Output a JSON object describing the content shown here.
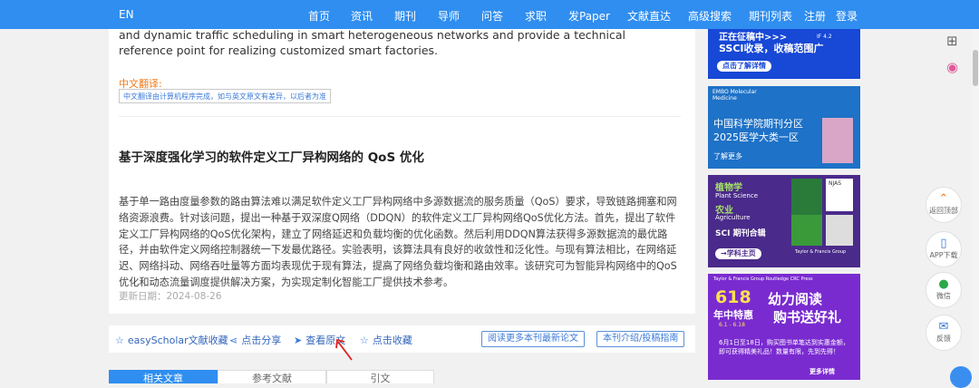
{
  "nav": {
    "lang": "EN",
    "items": [
      "首页",
      "资讯",
      "期刊",
      "导师",
      "问答",
      "求职",
      "发Paper",
      "文献直达",
      "高级搜索",
      "期刊列表",
      "注册",
      "登录"
    ]
  },
  "article": {
    "en_tail": "and dynamic traffic scheduling in smart heterogeneous networks and provide a technical reference point for realizing customized smart factories.",
    "cn_label": "中文翻译:",
    "cn_note": "中文翻译由计算机程序完成，如与英文原文有差异，以后者为准",
    "title": "基于深度强化学习的软件定义工厂异构网络的 QoS 优化",
    "abstract": "基于单一路由度量参数的路由算法难以满足软件定义工厂异构网络中多源数据流的服务质量（QoS）要求，导致链路拥塞和网络资源浪费。针对该问题，提出一种基于双深度Q网络（DDQN）的软件定义工厂异构网络QoS优化方法。首先，提出了软件定义工厂异构网络的QoS优化架构，建立了网络延迟和负载均衡的优化函数。然后利用DDQN算法获得多源数据流的最优路径，并由软件定义网络控制器统一下发最优路径。实验表明，该算法具有良好的收敛性和泛化性。与现有算法相比，在网络延迟、网络抖动、网络吞吐量等方面均表现优于现有算法，提高了网络负载均衡和路由效率。该研究可为智能异构网络中的QoS优化和动态流量调度提供解决方案，为实现定制化智能工厂提供技术参考。",
    "updated": "更新日期：2024-08-26"
  },
  "actions": {
    "collect_easyscholar": "easyScholar文献收藏",
    "share": "点击分享",
    "view_original": "查看原文",
    "favorite": "点击收藏",
    "more_papers": "阅读更多本刊最新论文",
    "journal_intro": "本刊介绍/投稿指南"
  },
  "tabs": [
    "相关文章",
    "参考文献",
    "引文"
  ],
  "ads": {
    "ad1_line1": "正在征稿中>>>",
    "ad1_line2": "SSCI收录，收稿范围广",
    "ad1_btn": "点击了解详情",
    "ad1_tag": "IF 4.2",
    "ad2_head": "EMBO Molecular Medicine",
    "ad2_line1": "中国科学院期刊分区",
    "ad2_line2": "2025医学大类一区",
    "ad2_more": "了解更多",
    "ad3_l1": "植物学",
    "ad3_l2": "Plant Science",
    "ad3_l3": "农业",
    "ad3_l4": "Agriculture",
    "ad3_l5": "SCI 期刊合辑",
    "ad3_btn": "→学科主页",
    "ad3_tag1": "NJAS",
    "ad3_pub": "Taylor & Francis Group",
    "ad4_pub": "Taylor & Francis Group  Routledge  CRC Press",
    "ad4_big": "618",
    "ad4_sub": "年中特惠",
    "ad4_date": "6.1 - 6.18",
    "ad4_slogan1": "幼力阅读",
    "ad4_slogan2": "购书送好礼",
    "ad4_text": "6月1日至18日，购买图书单笔达到实惠金额，即可获得精美礼品！数量有限，先到先得！",
    "ad4_more": "更多详情"
  },
  "side": {
    "back_top": "返回顶部",
    "app": "APP下载",
    "wechat": "微信",
    "feedback": "反馈"
  },
  "colors": {
    "nav_bg": "#2f8ef0",
    "accent_orange": "#f07a1a",
    "link_blue": "#3a7ad8"
  }
}
